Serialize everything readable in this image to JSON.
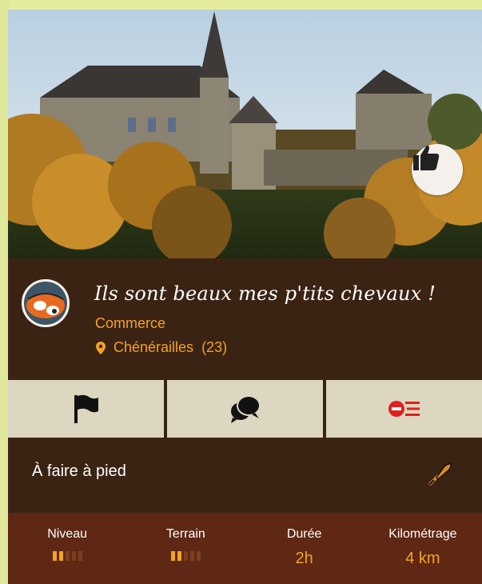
{
  "place": {
    "title": "Ils sont beaux mes p'tits chevaux !",
    "category": "Commerce",
    "location": "Chénérailles",
    "department": "(23)"
  },
  "icons": {
    "like": "thumbs-up-icon",
    "flag": "flag-icon",
    "comments": "chat-bubbles-icon",
    "remove": "remove-list-icon",
    "activity": "trowel-icon",
    "pin": "location-pin-icon"
  },
  "activity_mode": "À faire à pied",
  "stats": [
    {
      "label": "Niveau",
      "type": "bars",
      "level": 2,
      "max": 5
    },
    {
      "label": "Terrain",
      "type": "bars",
      "level": 2,
      "max": 5
    },
    {
      "label": "Durée",
      "type": "text",
      "value": "2h"
    },
    {
      "label": "Kilométrage",
      "type": "text",
      "value": "4 km"
    }
  ],
  "colors": {
    "accent": "#f4a224",
    "card_bg": "#3b2314",
    "stats_bg": "#5e2814",
    "action_bg": "#ddd6c0",
    "remove_red": "#e02020"
  }
}
